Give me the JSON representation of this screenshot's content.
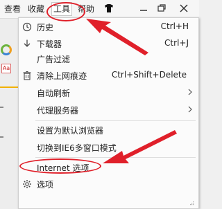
{
  "menubar": {
    "items": [
      "查看",
      "收藏",
      "工具",
      "帮助"
    ],
    "active_item": "工具"
  },
  "sidebar_strip": {
    "badge": "Aa"
  },
  "menu": {
    "items": [
      {
        "label": "历史",
        "shortcut": "Ctrl+H",
        "icon": "clock-icon"
      },
      {
        "label": "下载器",
        "shortcut": "Ctrl+J",
        "icon": "download-icon"
      },
      {
        "label": "广告过滤",
        "shortcut": ""
      },
      {
        "label": "清除上网痕迹",
        "shortcut": "Ctrl+Shift+Delete",
        "icon": "trash-icon"
      },
      {
        "label": "自动刷新",
        "submenu": true
      },
      {
        "label": "代理服务器",
        "submenu": true
      },
      {
        "label": "设置为默认浏览器"
      },
      {
        "label": "切换到IE6多窗口模式"
      },
      {
        "label": "Internet 选项"
      },
      {
        "label": "选项",
        "icon": "gear-icon"
      }
    ]
  },
  "annotations": {
    "color": "#e0202a"
  }
}
